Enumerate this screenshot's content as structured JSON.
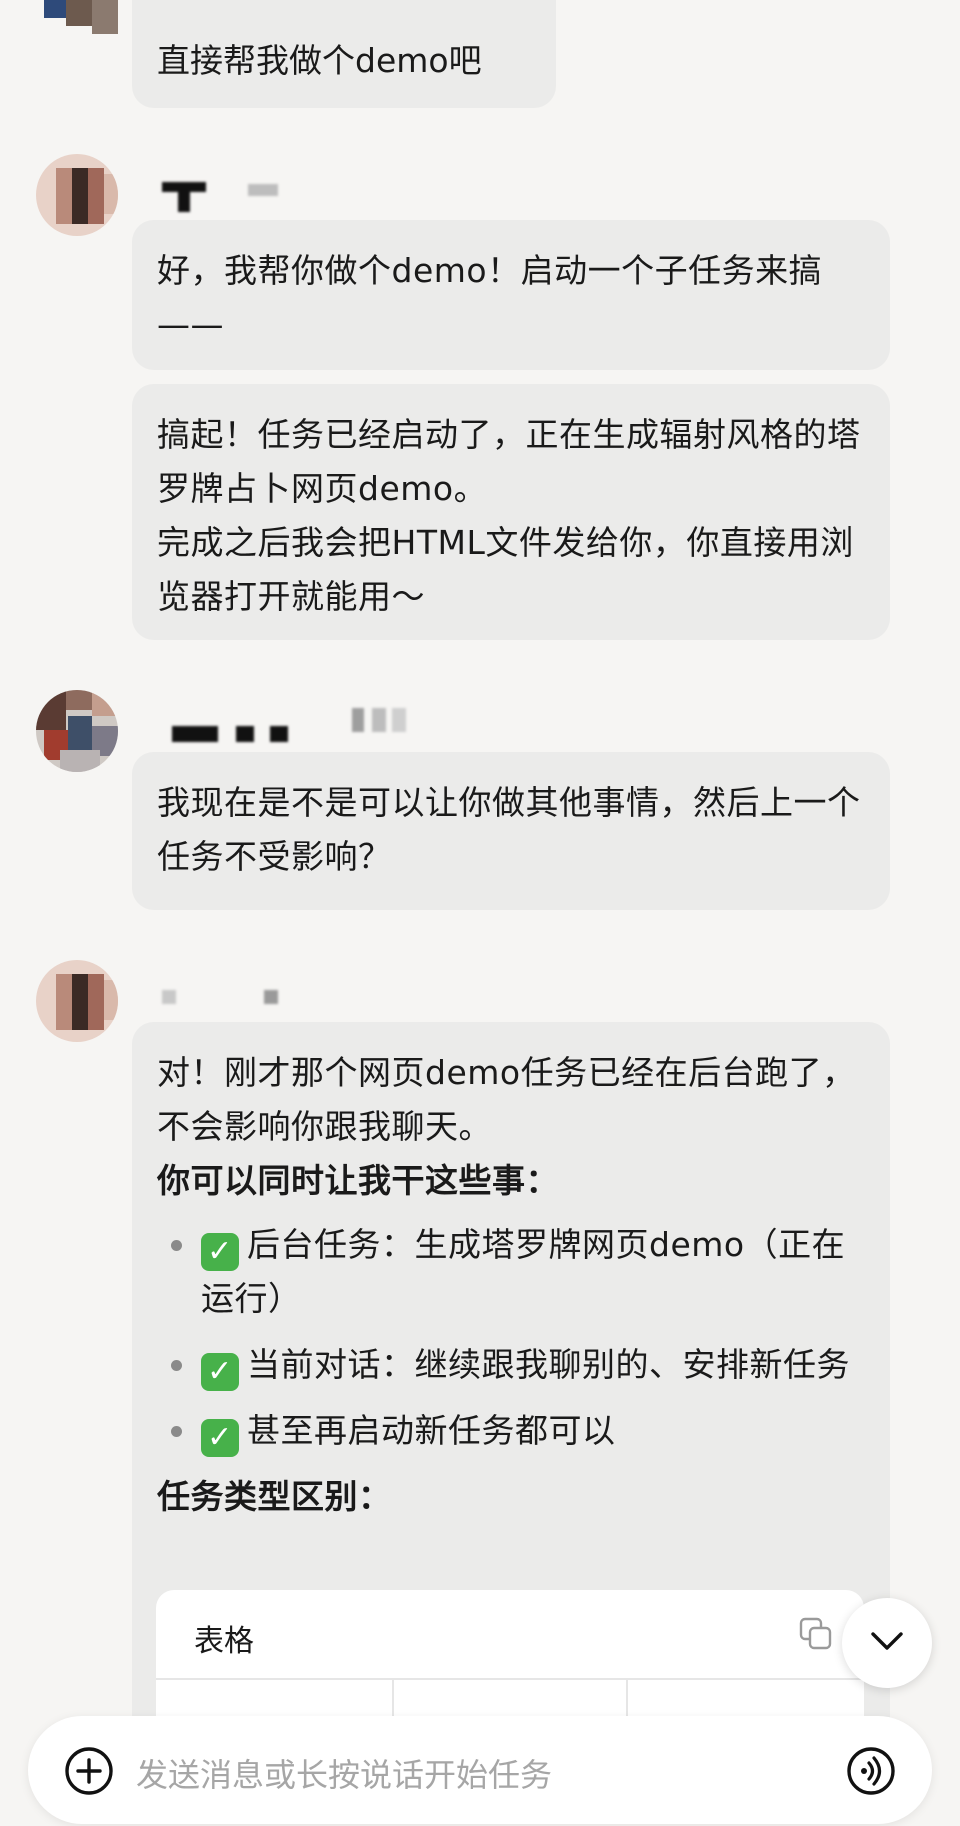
{
  "messages": [
    {
      "role": "user",
      "text": "直接帮我做个demo吧"
    },
    {
      "role": "assistant",
      "bubbles": [
        "好，我帮你做个demo！启动一个子任务来搞——",
        "搞起！任务已经启动了，正在生成辐射风格的塔罗牌占卜网页demo。",
        "完成之后我会把HTML文件发给你，你直接用浏览器打开就能用～"
      ]
    },
    {
      "role": "user",
      "text": "我现在是不是可以让你做其他事情，然后上一个任务不受影响？"
    },
    {
      "role": "assistant",
      "intro": "对！刚才那个网页demo任务已经在后台跑了，不会影响你跟我聊天。",
      "list_heading": "你可以同时让我干这些事：",
      "items": [
        {
          "check": "✓",
          "text": "后台任务：生成塔罗牌网页demo（正在运行）"
        },
        {
          "check": "✓",
          "text": "当前对话：继续跟我聊别的、安排新任务"
        },
        {
          "check": "✓",
          "text": "甚至再启动新任务都可以"
        }
      ],
      "section_heading": "任务类型区别：",
      "table_label": "表格"
    }
  ],
  "input": {
    "placeholder": "发送消息或长按说话开始任务"
  },
  "icons": {
    "copy": "copy-icon",
    "scroll_down": "chevron-down-icon",
    "add": "plus-circle-icon",
    "voice": "voice-icon"
  },
  "colors": {
    "background": "#f6f5f3",
    "bubble": "#ebebea",
    "check_green": "#47b14a"
  }
}
